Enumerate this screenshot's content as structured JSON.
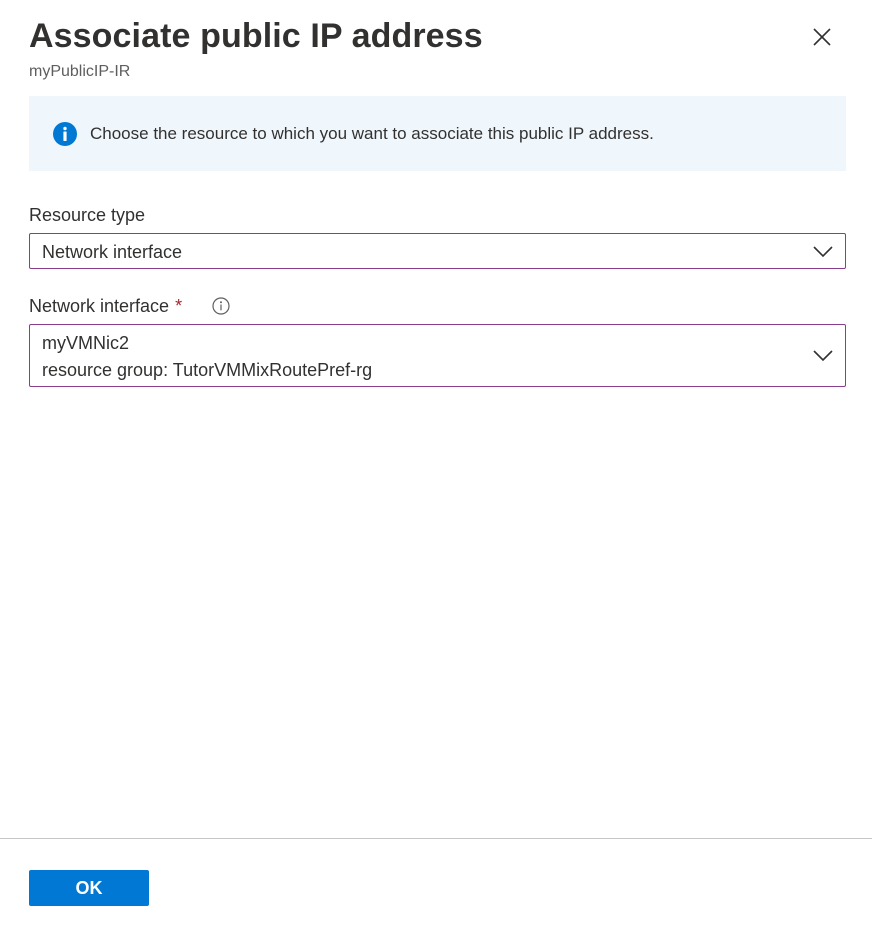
{
  "header": {
    "title": "Associate public IP address",
    "subtitle": "myPublicIP-IR",
    "close_icon": "close-icon"
  },
  "info": {
    "icon": "info-icon",
    "text": "Choose the resource to which you want to associate this public IP address."
  },
  "resource_type": {
    "label": "Resource type",
    "value": "Network interface"
  },
  "network_interface": {
    "label": "Network interface",
    "required_mark": "*",
    "tooltip_icon": "info-tooltip-icon",
    "value_line1": "myVMNic2",
    "value_line2": "resource group: TutorVMMixRoutePref-rg"
  },
  "footer": {
    "ok_label": "OK"
  },
  "colors": {
    "accent": "#0078d4",
    "info_background": "#eff6fc",
    "dropdown_border": "#8a3c8e",
    "required": "#a4262c"
  }
}
